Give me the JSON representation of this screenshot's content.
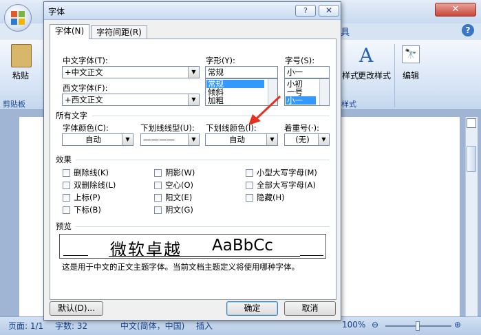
{
  "word": {
    "help_glyph": "?",
    "close_glyph": "✕",
    "ribbon_tab_tail": "具",
    "paste_label": "粘贴",
    "clipboard_group": "剪贴板",
    "styles_icon": "A",
    "style_label_a": "样式",
    "change_style_label": "更改样式",
    "edit_icon": "🔭",
    "edit_label": "编辑",
    "style_group_label": "样式",
    "status": {
      "page": "页面: 1/1",
      "words": "字数: 32",
      "language": "中文(简体，中国)",
      "insert": "插入",
      "zoom": "100%",
      "zoom_minus": "⊖",
      "zoom_plus": "⊕"
    }
  },
  "dialog": {
    "title": "字体",
    "help_button": "?",
    "close_button": "✕",
    "tabs": [
      "字体(N)",
      "字符间距(R)"
    ],
    "chinese_font_label": "中文字体(T):",
    "chinese_font_value": "+中文正文",
    "western_font_label": "西文字体(F):",
    "western_font_value": "+西文正文",
    "style_label": "字形(Y):",
    "style_value": "常规",
    "style_options": [
      "常规",
      "倾斜",
      "加粗"
    ],
    "size_label": "字号(S):",
    "size_value": "小一",
    "size_options": [
      "小初",
      "一号",
      "小一"
    ],
    "all_text_label": "所有文字",
    "font_color_label": "字体颜色(C):",
    "font_color_value": "自动",
    "underline_type_label": "下划线线型(U):",
    "underline_type_value": "————",
    "underline_color_label": "下划线颜色(I):",
    "underline_color_value": "自动",
    "emphasis_label": "着重号(·):",
    "emphasis_value": "(无)",
    "effects_label": "效果",
    "effects": [
      [
        "删除线(K)",
        "阴影(W)",
        "小型大写字母(M)"
      ],
      [
        "双删除线(L)",
        "空心(O)",
        "全部大写字母(A)"
      ],
      [
        "上标(P)",
        "阳文(E)",
        "隐藏(H)"
      ],
      [
        "下标(B)",
        "阴文(G)",
        ""
      ]
    ],
    "preview_label": "预览",
    "preview_cn": "微软卓越",
    "preview_en": "AaBbCc",
    "preview_desc": "这是用于中文的正文主题字体。当前文档主题定义将使用哪种字体。",
    "default_button": "默认(D)...",
    "ok_button": "确定",
    "cancel_button": "取消"
  },
  "colors": {
    "selection": "#3399ff",
    "annotation_arrow": "#e53020"
  }
}
